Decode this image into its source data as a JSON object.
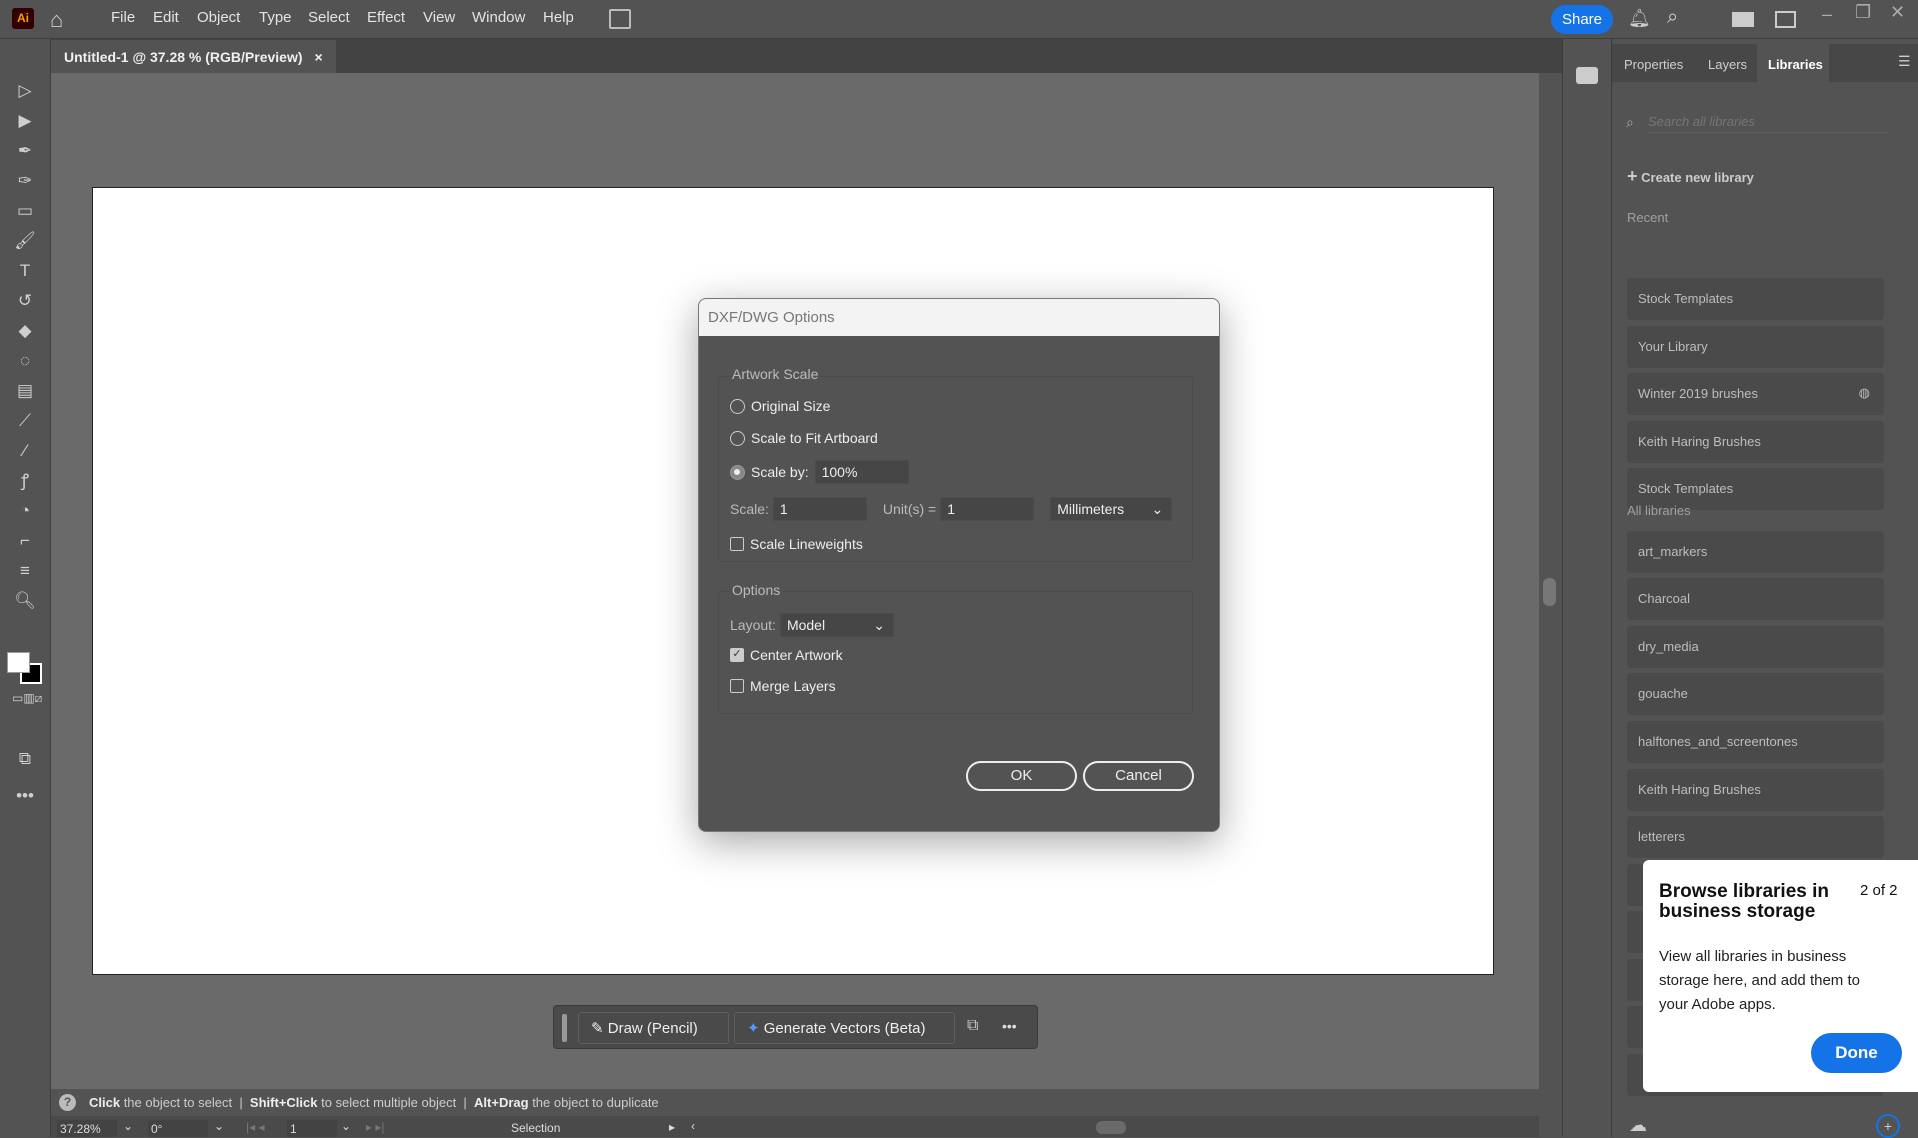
{
  "app": {
    "logo": "Ai",
    "menu": [
      "File",
      "Edit",
      "Object",
      "Type",
      "Select",
      "Effect",
      "View",
      "Window",
      "Help"
    ],
    "share": "Share"
  },
  "document": {
    "tab_title": "Untitled-1 @ 37.28 % (RGB/Preview)",
    "close": "×"
  },
  "panel": {
    "tabs": [
      "Properties",
      "Layers",
      "Libraries"
    ],
    "active_tab": "Libraries",
    "search_placeholder": "Search all libraries",
    "create": "Create new library",
    "recent_label": "Recent",
    "recent": [
      "Stock Templates",
      "Your Library",
      "Winter 2019 brushes",
      "Keith Haring Brushes",
      "Stock Templates"
    ],
    "all_label": "All libraries",
    "all": [
      "art_markers",
      "Charcoal",
      "dry_media",
      "gouache",
      "halftones_and_screentones",
      "Keith Haring Brushes",
      "letterers"
    ]
  },
  "dialog": {
    "title": "DXF/DWG Options",
    "artwork_scale": "Artwork Scale",
    "original_size": "Original Size",
    "scale_to_fit": "Scale to Fit Artboard",
    "scale_by": "Scale by:",
    "scale_by_value": "100%",
    "selected_scale_option": "Scale by",
    "scale_label": "Scale:",
    "scale_value": "1",
    "units_label": "Unit(s) =",
    "units_value": "1",
    "unit": "Millimeters",
    "scale_lineweights": "Scale Lineweights",
    "scale_lineweights_checked": false,
    "options": "Options",
    "layout_label": "Layout:",
    "layout": "Model",
    "center_artwork": "Center Artwork",
    "center_artwork_checked": true,
    "merge_layers": "Merge Layers",
    "merge_layers_checked": false,
    "ok": "OK",
    "cancel": "Cancel"
  },
  "floatbar": {
    "draw": "Draw (Pencil)",
    "generate": "Generate Vectors (Beta)",
    "more": "•••"
  },
  "status": {
    "click": "Click",
    "click_text": " the object to select  |  ",
    "shift": "Shift+Click",
    "shift_text": " to select multiple object  |  ",
    "alt": "Alt+Drag",
    "alt_text": " the object to duplicate"
  },
  "bottom": {
    "zoom": "37.28%",
    "rotation": "0°",
    "artboard": "1",
    "tool": "Selection"
  },
  "popover": {
    "title": "Browse libraries in business storage",
    "counter": "2 of 2",
    "body": "View all libraries in business storage here, and add them to your Adobe apps.",
    "done": "Done"
  },
  "colors": {
    "accent": "#1473e6",
    "ui": "#535353"
  }
}
